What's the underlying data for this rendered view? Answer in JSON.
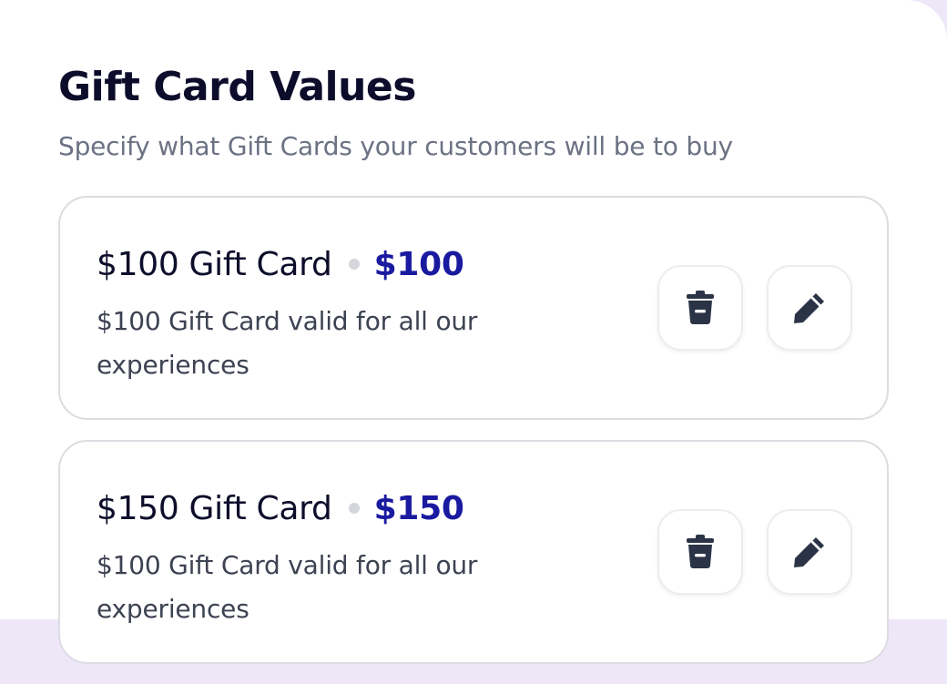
{
  "page": {
    "title": "Gift Card Values",
    "subtitle": "Specify what Gift Cards your customers will be to buy"
  },
  "cards": [
    {
      "name": "$100 Gift Card",
      "price": "$100",
      "description": "$100 Gift Card valid for all our experiences",
      "delete_icon": "trash-icon",
      "edit_icon": "pencil-icon"
    },
    {
      "name": "$150 Gift Card",
      "price": "$150",
      "description": "$100 Gift Card valid for all our experiences",
      "delete_icon": "trash-icon",
      "edit_icon": "pencil-icon"
    }
  ],
  "colors": {
    "title": "#0d0d2b",
    "subtitle": "#6c7283",
    "price_accent": "#1a1aa0",
    "icon": "#2b3346",
    "card_border": "#dcdce2",
    "background_tint": "#ede7f8"
  }
}
